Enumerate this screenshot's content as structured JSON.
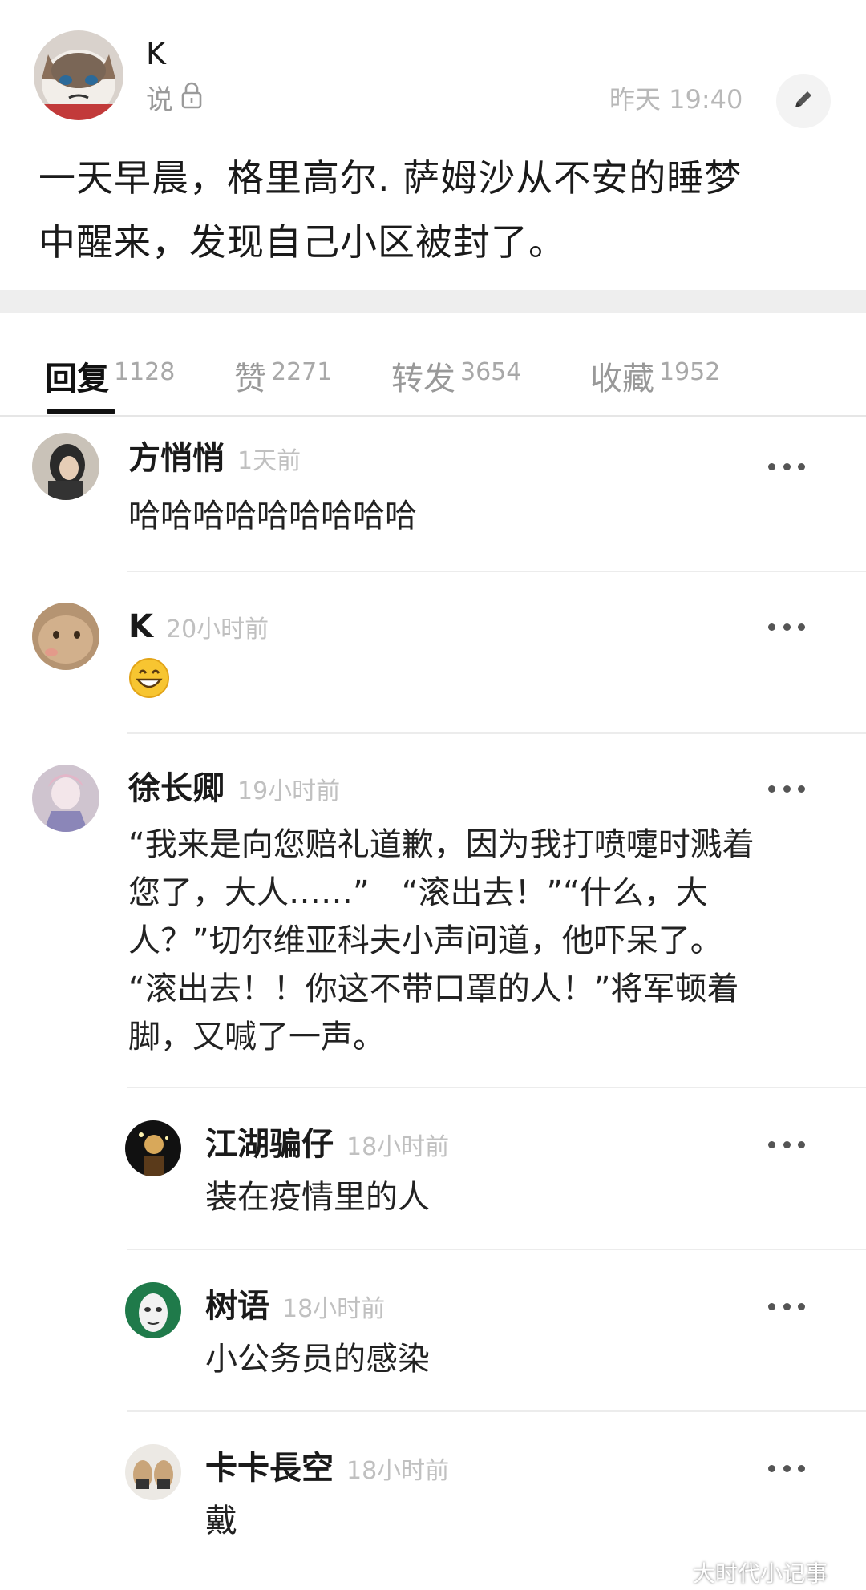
{
  "post": {
    "author": "K",
    "verb": "说",
    "time": "昨天 19:40",
    "text_line1": "一天早晨，格里高尔. 萨姆沙从不安的睡梦",
    "text_line2": "中醒来，发现自己小区被封了。"
  },
  "tabs": [
    {
      "label": "回复",
      "count": "1128",
      "active": true
    },
    {
      "label": "赞",
      "count": "2271"
    },
    {
      "label": "转发",
      "count": "3654"
    },
    {
      "label": "收藏",
      "count": "1952"
    }
  ],
  "comments": [
    {
      "name": "方悄悄",
      "time": "1天前",
      "text": "哈哈哈哈哈哈哈哈哈"
    },
    {
      "name": "K",
      "time": "20小时前",
      "text": "😁"
    },
    {
      "name": "徐长卿",
      "time": "19小时前",
      "lines": [
        "“我来是向您赔礼道歉，因为我打喷嚏时溅着",
        "您了，大人……”　“滚出去！”“什么，大",
        "人？”切尔维亚科夫小声问道，他吓呆了。",
        "“滚出去！！你这不带口罩的人！”将军顿着",
        "脚，又喊了一声。"
      ]
    }
  ],
  "replies": [
    {
      "name": "江湖骗仔",
      "time": "18小时前",
      "text": "装在疫情里的人"
    },
    {
      "name": "树语",
      "time": "18小时前",
      "text": "小公务员的感染"
    },
    {
      "name": "卡卡長空",
      "time": "18小时前",
      "text": "戴"
    }
  ],
  "watermark": "大时代小记事"
}
